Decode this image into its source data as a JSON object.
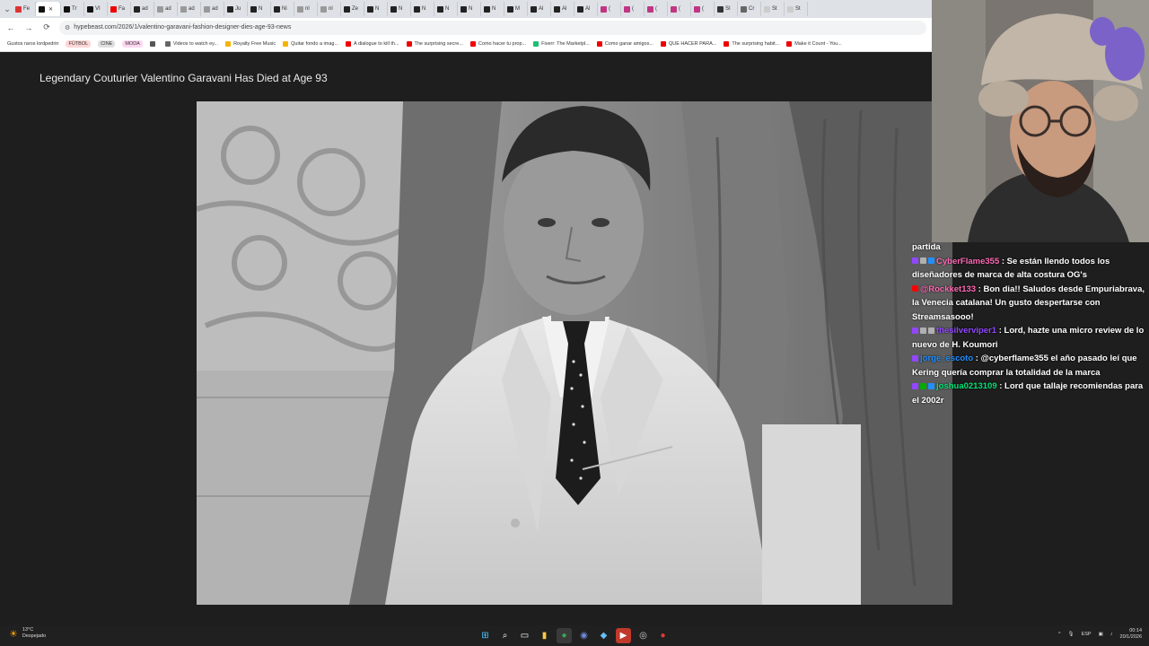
{
  "browser": {
    "tabs": [
      {
        "label": "Fe",
        "color": "#d33"
      },
      {
        "label": "",
        "color": "#111",
        "active": true
      },
      {
        "label": "Tr",
        "color": "#111"
      },
      {
        "label": "VI",
        "color": "#111"
      },
      {
        "label": "Fa",
        "color": "#e00"
      },
      {
        "label": "ad",
        "color": "#222"
      },
      {
        "label": "ad",
        "color": "#999"
      },
      {
        "label": "ad",
        "color": "#999"
      },
      {
        "label": "ad",
        "color": "#999"
      },
      {
        "label": "Ju",
        "color": "#222"
      },
      {
        "label": "N",
        "color": "#222"
      },
      {
        "label": "Ni",
        "color": "#222"
      },
      {
        "label": "nl",
        "color": "#999"
      },
      {
        "label": "nl",
        "color": "#999"
      },
      {
        "label": "Ze",
        "color": "#222"
      },
      {
        "label": "N",
        "color": "#222"
      },
      {
        "label": "N",
        "color": "#222"
      },
      {
        "label": "N",
        "color": "#222"
      },
      {
        "label": "N",
        "color": "#222"
      },
      {
        "label": "N",
        "color": "#222"
      },
      {
        "label": "N",
        "color": "#222"
      },
      {
        "label": "M",
        "color": "#222"
      },
      {
        "label": "Al",
        "color": "#222"
      },
      {
        "label": "Al",
        "color": "#222"
      },
      {
        "label": "Al",
        "color": "#222"
      },
      {
        "label": "(",
        "color": "#c13584"
      },
      {
        "label": "(",
        "color": "#c13584"
      },
      {
        "label": "(",
        "color": "#c13584"
      },
      {
        "label": "(",
        "color": "#c13584"
      },
      {
        "label": "(",
        "color": "#c13584"
      },
      {
        "label": "SI",
        "color": "#333"
      },
      {
        "label": "Cr",
        "color": "#666"
      },
      {
        "label": "St",
        "color": "#ccc"
      },
      {
        "label": "St",
        "color": "#ccc"
      }
    ],
    "url": "hypebeast.com/2026/1/valentino-garavani-fashion-designer-dies-age-93-news",
    "bookmarks": [
      {
        "label": "Gustos raros lordpedrin",
        "color": ""
      },
      {
        "label": "FÚTBOL",
        "color": "#ffd6d6",
        "pill": true
      },
      {
        "label": "CINE",
        "color": "#e0e0e0",
        "pill": true
      },
      {
        "label": "MODA",
        "color": "#ffd6f0",
        "pill": true
      },
      {
        "label": "",
        "color": "#555"
      },
      {
        "label": "Videos to watch ey...",
        "color": "#666"
      },
      {
        "label": "Royalty Free Music",
        "color": "#f5b400"
      },
      {
        "label": "Quitar fondo a imag...",
        "color": "#f5b400"
      },
      {
        "label": "A dialogue to kill th...",
        "color": "#e00"
      },
      {
        "label": "The surprising secre...",
        "color": "#e00"
      },
      {
        "label": "Como hacer tu prop...",
        "color": "#e00"
      },
      {
        "label": "Fiverr: The Marketpl...",
        "color": "#1dbf73"
      },
      {
        "label": "Como ganar amigos...",
        "color": "#e00"
      },
      {
        "label": "QUE HACER PARA...",
        "color": "#e00"
      },
      {
        "label": "The surprising habit...",
        "color": "#e00"
      },
      {
        "label": "Make it Count - You...",
        "color": "#e00"
      }
    ]
  },
  "article": {
    "title": "Legendary Couturier Valentino Garavani Has Died at Age 93"
  },
  "chat": {
    "messages": [
      {
        "badges": [],
        "user": "",
        "user_color": "#ffffff",
        "text": "partida"
      },
      {
        "badges": [
          "b-tw",
          "b-grey",
          "b-sub"
        ],
        "user": "CyberFlame355",
        "user_color": "#ff69b4",
        "text": ": Se están llendo todos los diseñadores de marca de alta costura OG's"
      },
      {
        "badges": [
          "b-yt"
        ],
        "user": "@Rockket133",
        "user_color": "#ff69b4",
        "text": ": Bon dia!! Saludos desde Empuriabrava, la Venecia catalana! Un gusto despertarse con Streamsasooo!"
      },
      {
        "badges": [
          "b-tw",
          "b-grey",
          "b-grey"
        ],
        "user": "thesilverviper1",
        "user_color": "#9146ff",
        "text": ": Lord, hazte una micro review de lo nuevo de H. Koumori"
      },
      {
        "badges": [
          "b-tw"
        ],
        "user": "jorge_escoto",
        "user_color": "#1e90ff",
        "text": ": @cyberflame355 el año pasado leí que Kering quería comprar la totalidad de la marca"
      },
      {
        "badges": [
          "b-tw",
          "b-mod",
          "b-sub"
        ],
        "user": "joshua0213109",
        "user_color": "#00e676",
        "text": ": Lord que tallaje recomiendas para el 2002r"
      }
    ]
  },
  "taskbar": {
    "temperature": "13°C",
    "weather": "Despejado",
    "lang": "ESP",
    "time": "00:14",
    "date": "20/1/2026"
  }
}
